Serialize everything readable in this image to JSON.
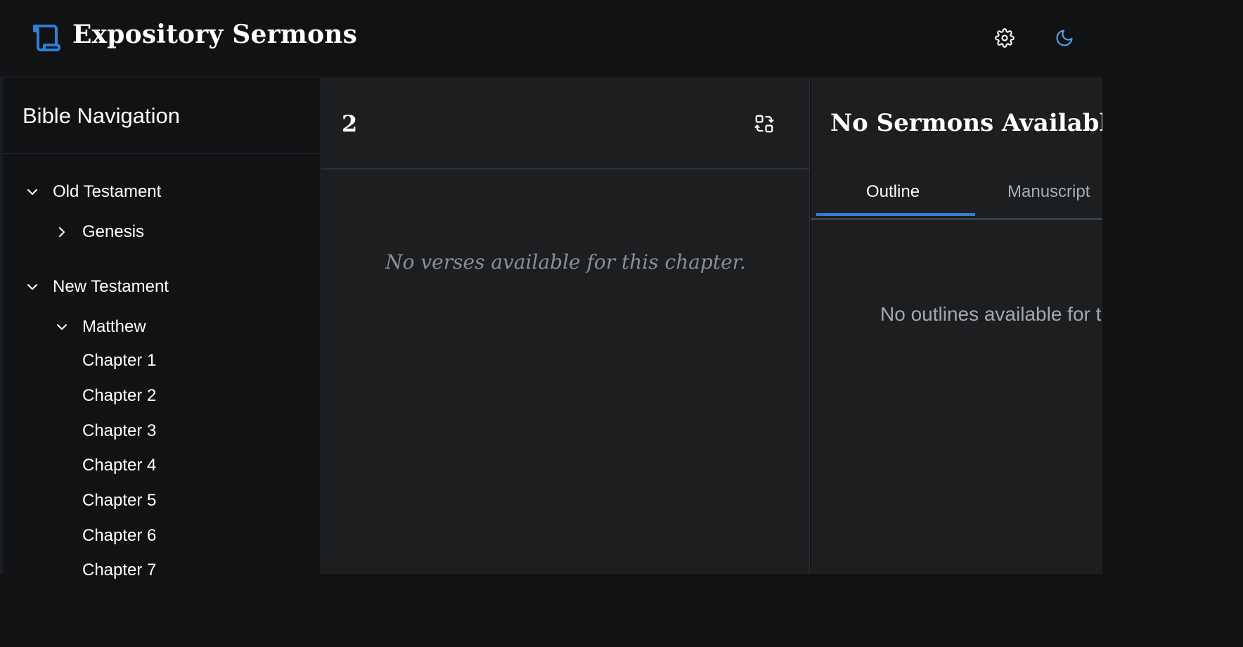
{
  "app": {
    "title": "Expository Sermons",
    "logo_icon": "scroll-icon",
    "accent_color": "#2f7fd6"
  },
  "header": {
    "settings_icon": "gear-icon",
    "theme_icon": "moon-icon"
  },
  "sidebar": {
    "title": "Bible Navigation",
    "testaments": [
      {
        "label": "Old Testament",
        "expanded": true,
        "books": [
          {
            "label": "Genesis",
            "expanded": false
          }
        ]
      },
      {
        "label": "New Testament",
        "expanded": true,
        "books": [
          {
            "label": "Matthew",
            "expanded": true,
            "chapters": [
              "Chapter 1",
              "Chapter 2",
              "Chapter 3",
              "Chapter 4",
              "Chapter 5",
              "Chapter 6",
              "Chapter 7"
            ]
          }
        ]
      }
    ]
  },
  "scripture": {
    "chapter_number": "2",
    "compare_icon": "compare-icon",
    "empty_message": "No verses available for this chapter."
  },
  "sermon": {
    "title": "No Sermons Available",
    "tabs": [
      {
        "label": "Outline",
        "active": true
      },
      {
        "label": "Manuscript",
        "active": false
      }
    ],
    "empty_message": "No outlines available for this chapter"
  }
}
